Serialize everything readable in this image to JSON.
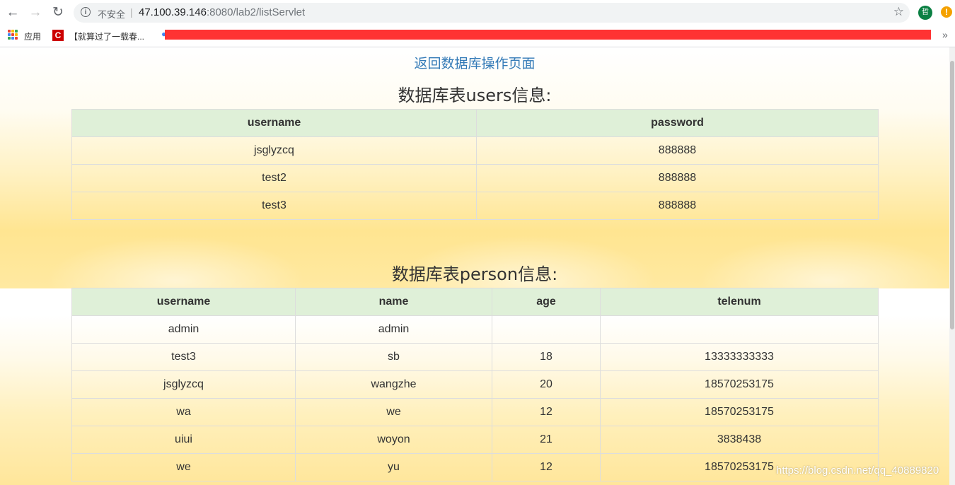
{
  "browser": {
    "security_label": "不安全",
    "separator": "|",
    "url_host": "47.100.39.146",
    "url_rest": ":8080/lab2/listServlet",
    "profile_initial": "哲",
    "alert_symbol": "!",
    "bookmarks": {
      "apps_label": "应用",
      "item1_label": "【就算过了一载春..."
    },
    "colors": {
      "apps_grid": [
        "#ea4335",
        "#fbbc05",
        "#34a853",
        "#4285f4",
        "#ea4335",
        "#fbbc05",
        "#34a853",
        "#4285f4",
        "#ea4335"
      ]
    }
  },
  "page": {
    "back_link": "返回数据库操作页面",
    "users_table": {
      "title": "数据库表users信息:",
      "columns": [
        "username",
        "password"
      ],
      "rows": [
        [
          "jsglyzcq",
          "888888"
        ],
        [
          "test2",
          "888888"
        ],
        [
          "test3",
          "888888"
        ]
      ]
    },
    "person_table": {
      "title": "数据库表person信息:",
      "columns": [
        "username",
        "name",
        "age",
        "telenum"
      ],
      "rows": [
        [
          "admin",
          "admin",
          "",
          ""
        ],
        [
          "test3",
          "sb",
          "18",
          "13333333333"
        ],
        [
          "jsglyzcq",
          "wangzhe",
          "20",
          "18570253175"
        ],
        [
          "wa",
          "we",
          "12",
          "18570253175"
        ],
        [
          "uiui",
          "woyon",
          "21",
          "3838438"
        ],
        [
          "we",
          "yu",
          "12",
          "18570253175"
        ]
      ]
    },
    "watermark": "https://blog.csdn.net/qq_40889820"
  }
}
